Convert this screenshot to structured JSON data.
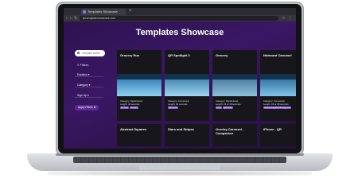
{
  "browser": {
    "tab_title": "Templates Showcase",
    "url": "tpl.templateshowcase.com"
  },
  "page": {
    "title": "Templates Showcase"
  },
  "sidebar": {
    "search_placeholder": "Template Name",
    "filters_label": "Filters",
    "filter_items": [
      "Duration",
      "Category",
      "Sign Up"
    ],
    "apply_label": "Apply Filters"
  },
  "cards_row1": [
    {
      "title": "Grocery Run",
      "category_line": "Category: Digital Asset",
      "length_line": "Length: 30 seconds",
      "tags": [
        "All Time",
        "Grocery"
      ]
    },
    {
      "title": "QR Spotlight 2",
      "category_line": "Category: Companion",
      "length_line": "Length: 30 seconds",
      "tags": [
        "QR Code"
      ]
    },
    {
      "title": "Grocery",
      "category_line": "Category: Digital Asset",
      "length_line": "Length: 15 or 30 seconds",
      "tags": [
        "Food",
        "QR Code"
      ]
    },
    {
      "title": "Notecard Carousel",
      "category_line": "Category: Companion",
      "length_line": "Length: 15 or 30 seconds",
      "tags": [
        "Interchangeable Background"
      ]
    }
  ],
  "cards_row2": [
    {
      "title": "Abstract Squares"
    },
    {
      "title": "Stars and Stripes"
    },
    {
      "title": "Overlay Carousel - Companion"
    },
    {
      "title": "iPhone - QR"
    }
  ],
  "colors": {
    "accent": "#8b5bd6",
    "page_bg": "#2d1250"
  }
}
